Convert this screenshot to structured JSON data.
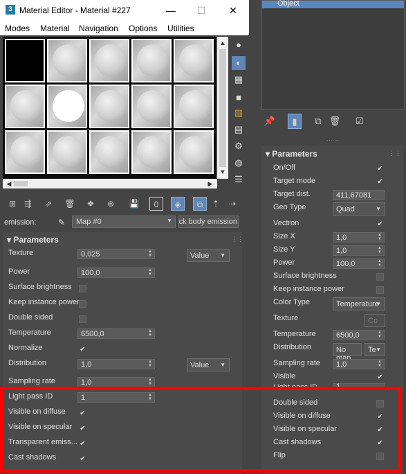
{
  "window": {
    "app_icon": "3",
    "title": "Material Editor - Material #227",
    "minimize": "—",
    "maximize": "☐",
    "close": "✕"
  },
  "menu": [
    "Modes",
    "Material",
    "Navigation",
    "Options",
    "Utilities"
  ],
  "emission": {
    "label": "emission:",
    "map": "Map #0",
    "material_name": "lack body emission"
  },
  "left_params": {
    "header": "Parameters",
    "texture": {
      "label": "Texture",
      "value": "0,025",
      "mode": "Value"
    },
    "power": {
      "label": "Power",
      "value": "100,0"
    },
    "surface_brightness": {
      "label": "Surface brightness",
      "checked": false
    },
    "keep_instance_power": {
      "label": "Keep instance power",
      "checked": false
    },
    "double_sided": {
      "label": "Double sided",
      "checked": false
    },
    "temperature": {
      "label": "Temperature",
      "value": "6500,0"
    },
    "normalize": {
      "label": "Normalize",
      "checked": true
    },
    "distribution": {
      "label": "Distribution",
      "value": "1,0",
      "mode": "Value"
    },
    "sampling_rate": {
      "label": "Sampling rate",
      "value": "1,0"
    },
    "light_pass_id": {
      "label": "Light pass ID",
      "value": "1"
    },
    "visible_on_diffuse": {
      "label": "Visible on diffuse",
      "checked": true
    },
    "visible_on_specular": {
      "label": "Visible on specular",
      "checked": true
    },
    "transparent_emission": {
      "label": "Transparent emiss...",
      "checked": true
    },
    "cast_shadows": {
      "label": "Cast shadows",
      "checked": true
    }
  },
  "right_panel": {
    "selected_object": "Object",
    "header": "Parameters",
    "on_off": {
      "label": "On/Off",
      "checked": true
    },
    "target_mode": {
      "label": "Target mode",
      "checked": true
    },
    "target_dist": {
      "label": "Target dist.",
      "value": "411,67081"
    },
    "geo_type": {
      "label": "Geo Type",
      "value": "Quad"
    },
    "vectron": {
      "label": "Vectron",
      "checked": true
    },
    "size_x": {
      "label": "Size X",
      "value": "1,0"
    },
    "size_y": {
      "label": "Size Y",
      "value": "1,0"
    },
    "power": {
      "label": "Power",
      "value": "100,0"
    },
    "surface_brightness": {
      "label": "Surface brightness",
      "checked": false
    },
    "keep_instance_power": {
      "label": "Keep instance power",
      "checked": false
    },
    "color_type": {
      "label": "Color Type",
      "value": "Temperature"
    },
    "texture": {
      "label": "Texture",
      "value": "Co"
    },
    "temperature": {
      "label": "Temperature",
      "value": "6500,0"
    },
    "distribution": {
      "label": "Distribution",
      "map": "No map",
      "mode": "Te"
    },
    "sampling_rate": {
      "label": "Sampling rate",
      "value": "1,0"
    },
    "visible": {
      "label": "Visible",
      "checked": true
    },
    "light_pass_id": {
      "label": "Light pass ID",
      "value": "1"
    },
    "double_sided": {
      "label": "Double sided",
      "checked": false
    },
    "visible_on_diffuse": {
      "label": "Visible on diffuse",
      "checked": true
    },
    "visible_on_specular": {
      "label": "Visible on specular",
      "checked": true
    },
    "cast_shadows": {
      "label": "Cast shadows",
      "checked": true
    },
    "flip": {
      "label": "Flip",
      "checked": false
    }
  },
  "icons": {
    "check": "✔",
    "dropdown": "▼",
    "spin": "▲▼",
    "expand": "▾"
  },
  "colors": {
    "panel_bg": "#444444",
    "rollout_bg": "#4a4a4a",
    "field_bg": "#5a5a5a",
    "accent": "#5f86b6",
    "highlight": "#ff0000"
  }
}
